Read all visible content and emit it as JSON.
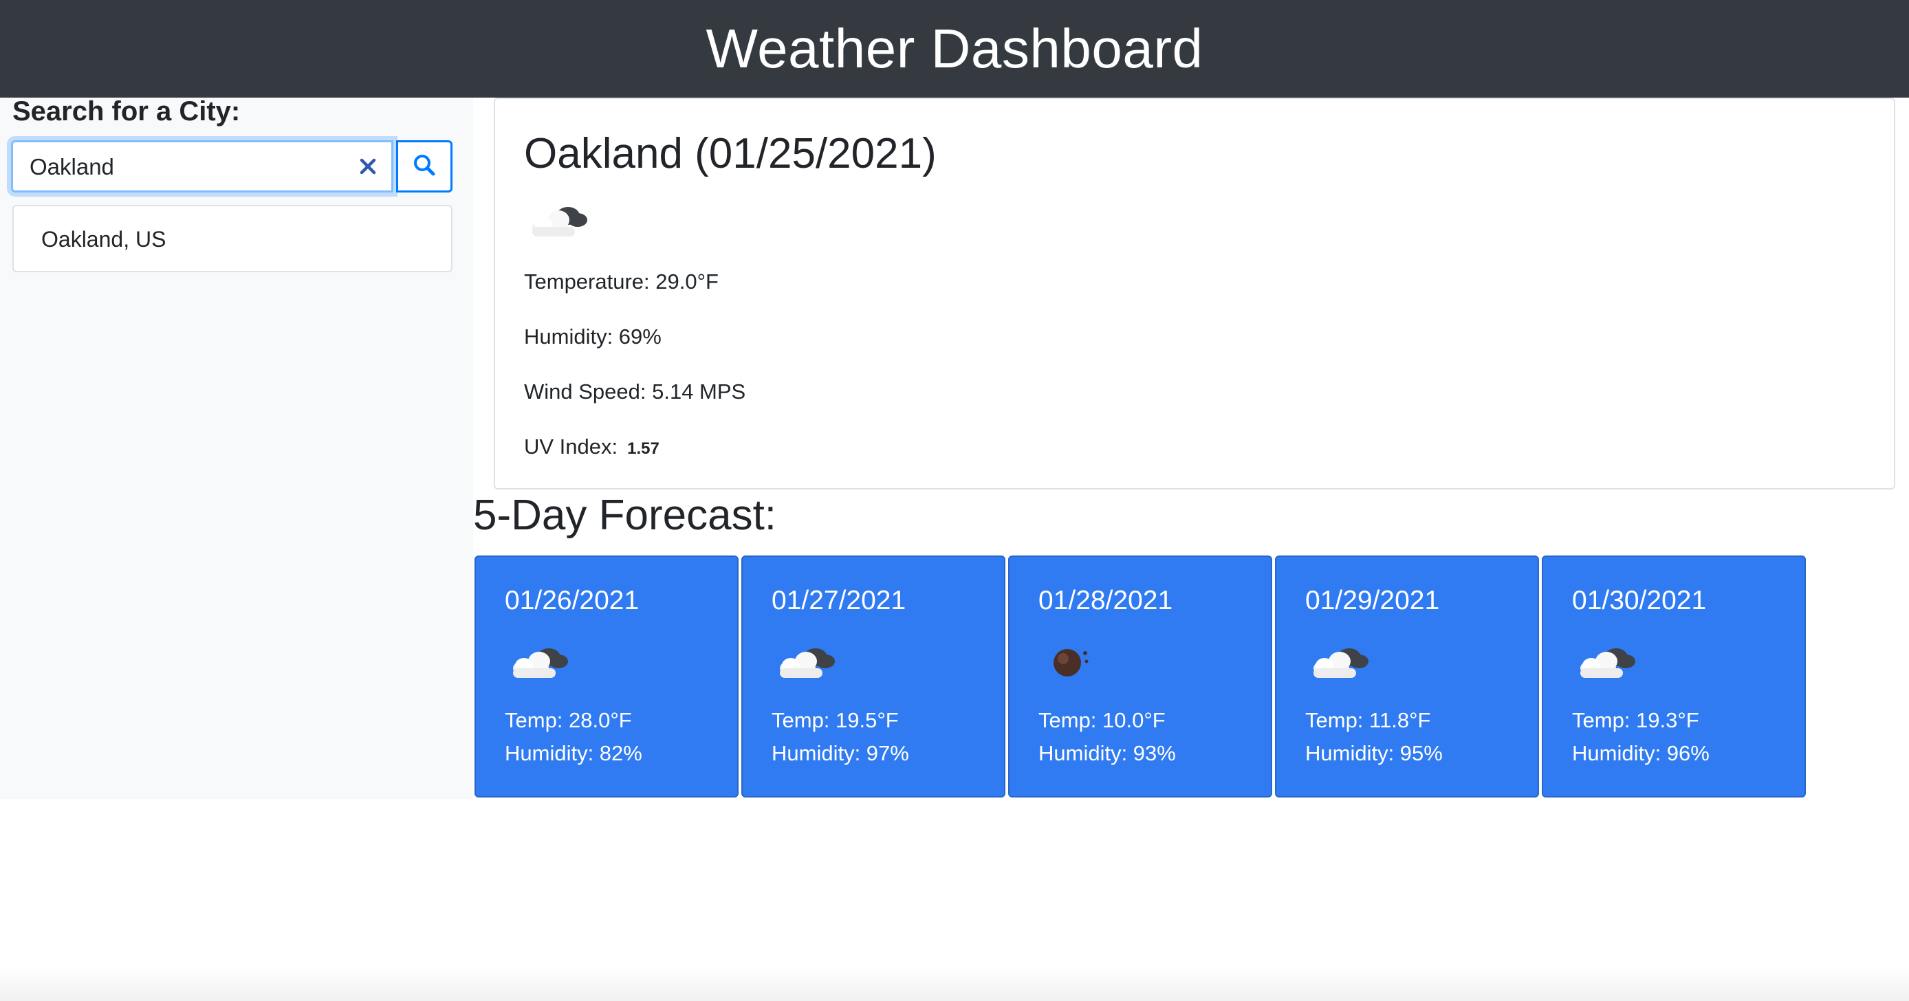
{
  "header": {
    "title": "Weather Dashboard"
  },
  "search": {
    "label": "Search for a City:",
    "value": "Oakland",
    "suggestions": [
      "Oakland, US"
    ]
  },
  "current": {
    "title": "Oakland (01/25/2021)",
    "icon": "cloudy-icon",
    "temperature": "Temperature: 29.0°F",
    "humidity": "Humidity: 69%",
    "wind": "Wind Speed: 5.14 MPS",
    "uv_label": "UV Index:",
    "uv_value": "1.57"
  },
  "forecast": {
    "title": "5-Day Forecast:",
    "days": [
      {
        "date": "01/26/2021",
        "icon": "cloudy-icon",
        "temp": "Temp: 28.0°F",
        "humidity": "Humidity: 82%"
      },
      {
        "date": "01/27/2021",
        "icon": "cloudy-icon",
        "temp": "Temp: 19.5°F",
        "humidity": "Humidity: 97%"
      },
      {
        "date": "01/28/2021",
        "icon": "rain-icon",
        "temp": "Temp: 10.0°F",
        "humidity": "Humidity: 93%"
      },
      {
        "date": "01/29/2021",
        "icon": "cloudy-icon",
        "temp": "Temp: 11.8°F",
        "humidity": "Humidity: 95%"
      },
      {
        "date": "01/30/2021",
        "icon": "cloudy-icon",
        "temp": "Temp: 19.3°F",
        "humidity": "Humidity: 96%"
      }
    ]
  },
  "colors": {
    "header_bg": "#343a40",
    "card_bg": "#307bf1",
    "accent": "#007bff"
  }
}
